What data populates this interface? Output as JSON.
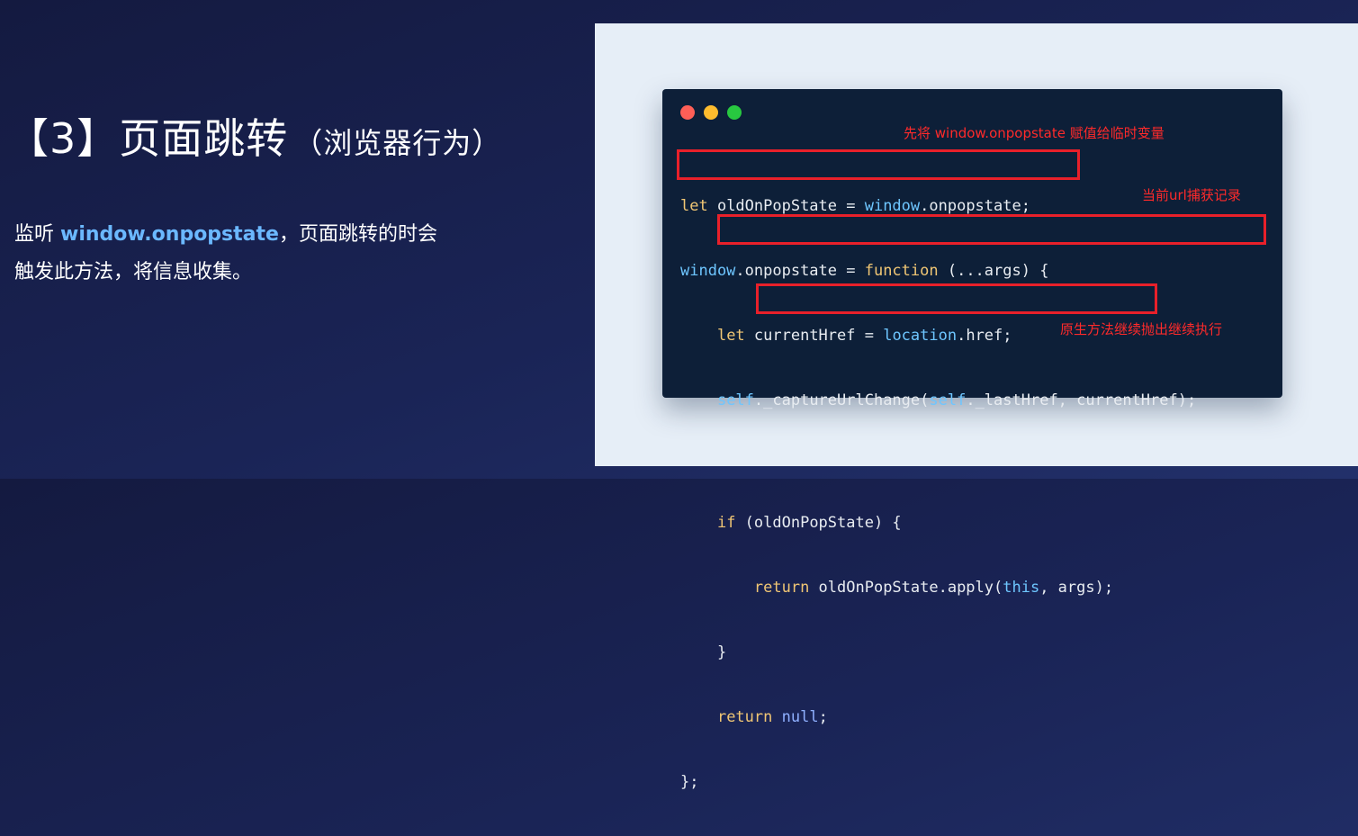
{
  "title": {
    "main": "【3】页面跳转",
    "sub": "（浏览器行为）"
  },
  "description": {
    "prefix": "监听 ",
    "keyword": "window.onpopstate",
    "suffix_line1": "，页面跳转的时会",
    "line2": "触发此方法，将信息收集。"
  },
  "code_lines": {
    "l1_k": "let",
    "l1_rest": " oldOnPopState = ",
    "l1_v": "window",
    "l1_end": ".onpopstate;",
    "l2_v": "window",
    "l2_mid": ".onpopstate = ",
    "l2_k": "function",
    "l2_end": " (...args) {",
    "l3_k": "let",
    "l3_mid": " currentHref = ",
    "l3_v": "location",
    "l3_end": ".href;",
    "l4_v1": "self",
    "l4_mid": "._captureUrlChange(",
    "l4_v2": "self",
    "l4_end": "._lastHref, currentHref);",
    "l5_k": "if",
    "l5_end": " (oldOnPopState) {",
    "l6_k": "return",
    "l6_mid": " oldOnPopState.apply(",
    "l6_v": "this",
    "l6_end": ", args);",
    "l7": "}",
    "l8_k": "return",
    "l8_n": "null",
    "l8_end": ";",
    "l9": "};"
  },
  "annotations": {
    "note1": "先将 window.onpopstate 赋值给临时变量",
    "note2": "当前url捕获记录",
    "note3": "原生方法继续抛出继续执行"
  },
  "colors": {
    "highlight": "#e8202a",
    "keyword": "#6bb8ff",
    "annotation": "#ff2a2a"
  }
}
